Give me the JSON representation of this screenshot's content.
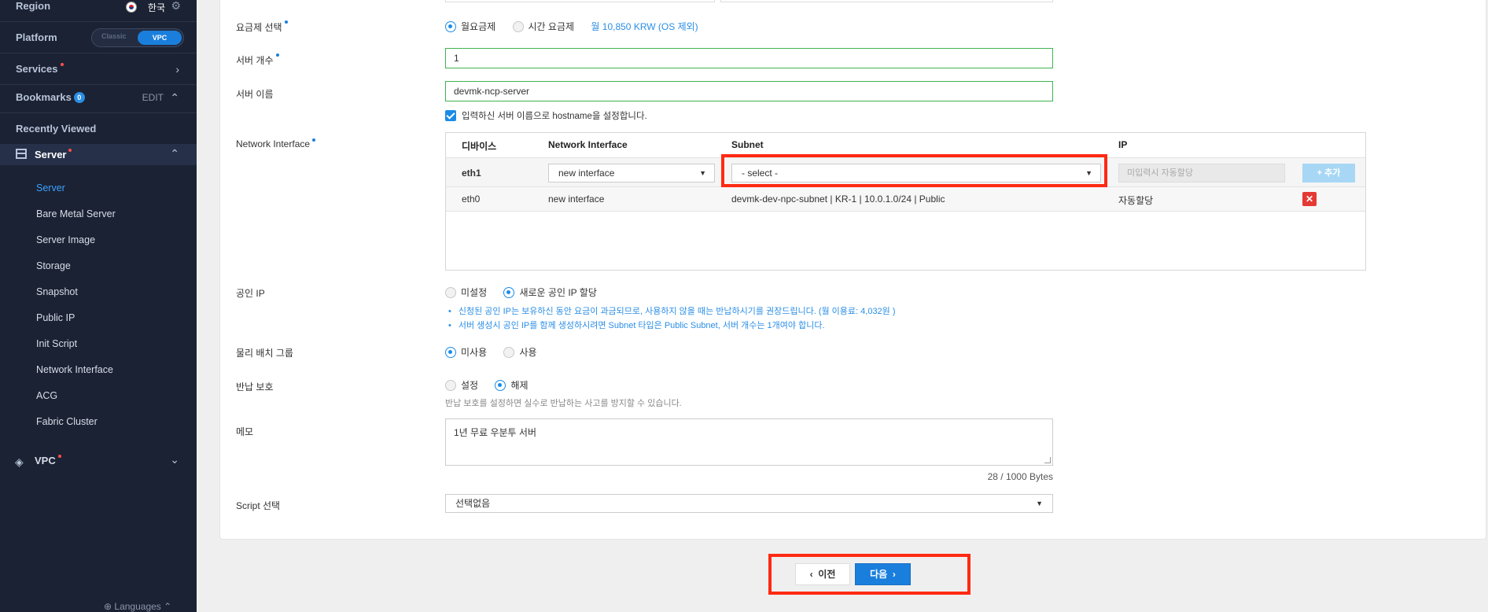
{
  "sidebar": {
    "region_label": "Region",
    "region_value": "한국",
    "platform_label": "Platform",
    "platform_classic": "Classic",
    "platform_vpc": "VPC",
    "services_label": "Services",
    "bookmarks_label": "Bookmarks",
    "bookmarks_count": "0",
    "bookmarks_edit": "EDIT",
    "recently_viewed": "Recently Viewed",
    "server_label": "Server",
    "server_items": [
      "Server",
      "Bare Metal Server",
      "Server Image",
      "Storage",
      "Snapshot",
      "Public IP",
      "Init Script",
      "Network Interface",
      "ACG",
      "Fabric Cluster"
    ],
    "vpc_label": "VPC",
    "languages": "Languages"
  },
  "form": {
    "plan_label": "요금제 선택",
    "plan_monthly": "월요금제",
    "plan_hourly": "시간 요금제",
    "plan_price": "월 10,850 KRW (OS 제외)",
    "count_label": "서버 개수",
    "count_value": "1",
    "name_label": "서버 이름",
    "name_value": "devmk-ncp-server",
    "hostname_check": "입력하신 서버 이름으로 hostname을 설정합니다.",
    "ni_label": "Network Interface",
    "public_ip_label": "공인 IP",
    "public_ip_none": "미설정",
    "public_ip_new": "새로운 공인 IP 할당",
    "public_ip_note1": "신청된 공인 IP는 보유하신 동안 요금이 과금되므로, 사용하지 않을 때는 반납하시기를 권장드립니다. (월 이용료: 4,032원 )",
    "public_ip_note2": "서버 생성시 공인 IP를 함께 생성하시려면 Subnet 타입은 Public Subnet, 서버 개수는 1개여야 합니다.",
    "placement_label": "물리 배치 그룹",
    "placement_off": "미사용",
    "placement_on": "사용",
    "return_label": "반납 보호",
    "return_on": "설정",
    "return_off": "해제",
    "return_hint": "반납 보호를 설정하면 실수로 반납하는 사고를 방지할 수 있습니다.",
    "memo_label": "메모",
    "memo_value": "1년 무료 우분투 서버",
    "memo_bytes": "28 / 1000 Bytes",
    "script_label": "Script 선택",
    "script_value": "선택없음"
  },
  "ni_table": {
    "headers": [
      "디바이스",
      "Network Interface",
      "Subnet",
      "IP"
    ],
    "new_row": {
      "device": "eth1",
      "interface": "new interface",
      "subnet": "- select -",
      "ip_placeholder": "미입력시 자동할당",
      "add": "+ 추가"
    },
    "rows": [
      {
        "device": "eth0",
        "interface": "new interface",
        "subnet": "devmk-dev-npc-subnet | KR-1 | 10.0.1.0/24 | Public",
        "ip": "자동할당",
        "delete": "✕"
      }
    ]
  },
  "footer": {
    "prev": "이전",
    "next": "다음"
  },
  "colors": {
    "accent": "#1a7fdc",
    "highlight": "#ff2a12",
    "sidebar_bg": "#1b2233"
  }
}
